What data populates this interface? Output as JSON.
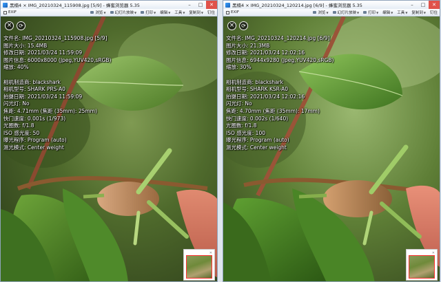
{
  "toolbar": {
    "exif": "EXIF",
    "browse": "浏览",
    "slideshow": "幻灯片放映",
    "print": "打印",
    "edit": "编辑",
    "tools": "工具",
    "copy_to": "复制到",
    "pin": "钉住"
  },
  "windows": [
    {
      "title": "黑楠4 × IMG_20210324_115908.jpg [5/9] - 蜂蜜浏览器 5.35",
      "exif": {
        "filename": "文件名: IMG_20210324_115908.jpg [5/9]",
        "size": "图片大小: 15.4MB",
        "modified": "修改日期: 2021/03/24 11:59:09",
        "info": "图片信息: 6000x8000 (Jpeg,YUV420,sRGB)",
        "zoom": "缩放: 40%",
        "maker": "相机制造商: blackshark",
        "model": "相机型号: SHARK PRS-A0",
        "shot_date": "拍摄日期: 2021/03/24 11:59:09",
        "flash": "闪光灯: No",
        "focal": "焦距: 4.71mm (焦距 (35mm): 25mm)",
        "shutter": "快门速度: 0.001s (1/973)",
        "aperture": "光圈数: f/1.8",
        "iso": "ISO 感光度: 50",
        "program": "曝光程序: Program (auto)",
        "metering": "测光模式: Center weight"
      }
    },
    {
      "title": "黑楠4 × IMG_20210324_120214.jpg [6/9] - 蜂蜜浏览器 5.35",
      "exif": {
        "filename": "文件名: IMG_20210324_120214.jpg [6/9]",
        "size": "图片大小: 21.3MB",
        "modified": "修改日期: 2021/03/24 12:02:16",
        "info": "图片信息: 6944x9280 (Jpeg,YUV420,sRGB)",
        "zoom": "缩放: 30%",
        "maker": "相机制造商: blackshark",
        "model": "相机型号: SHARK KSR-A0",
        "shot_date": "拍摄日期: 2021/03/24 12:02:16",
        "flash": "闪光灯: No",
        "focal": "焦距: 4.70mm (焦距 (35mm): 17mm)",
        "shutter": "快门速度: 0.002s (1/640)",
        "aperture": "光圈数: f/1.8",
        "iso": "ISO 感光度: 100",
        "program": "曝光程序: Program (auto)",
        "metering": "测光模式: Center weight"
      }
    }
  ]
}
